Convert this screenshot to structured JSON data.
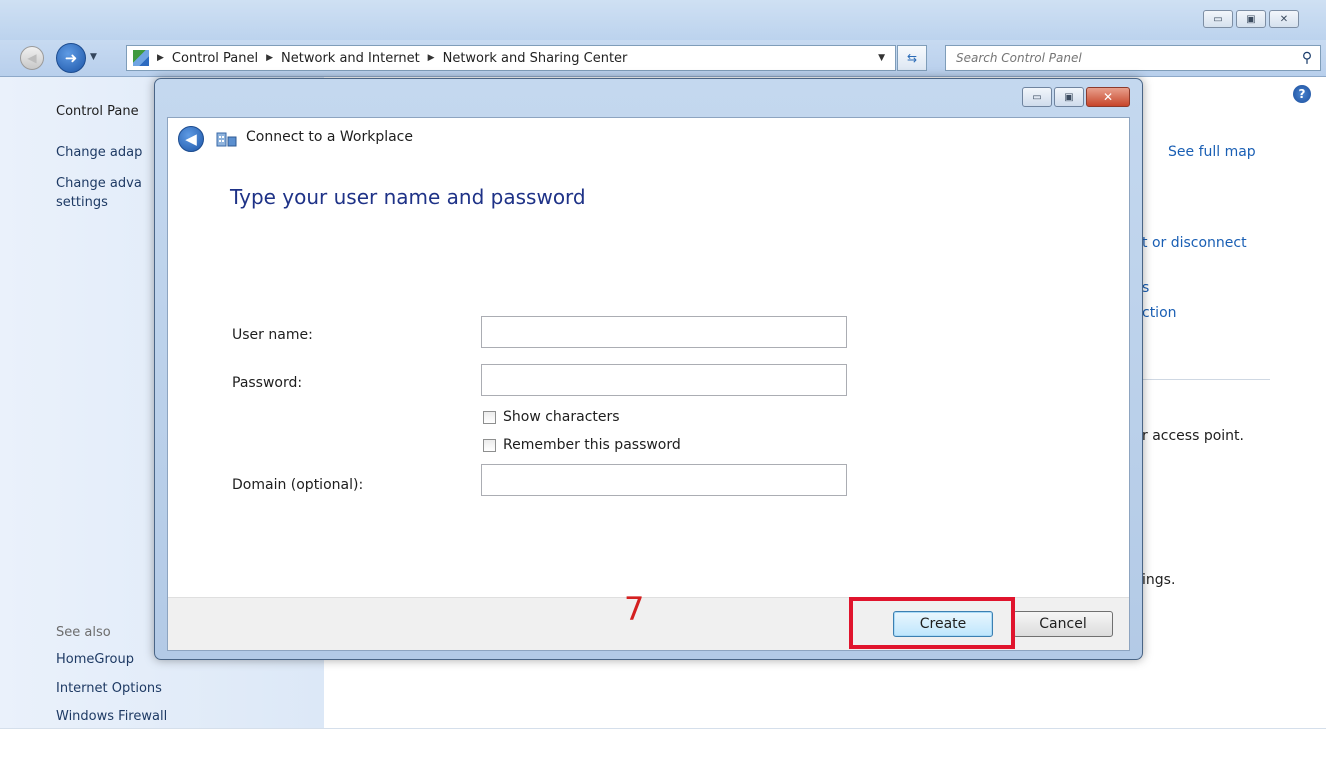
{
  "breadcrumbs": [
    "Control Panel",
    "Network and Internet",
    "Network and Sharing Center"
  ],
  "search": {
    "placeholder": "Search Control Panel"
  },
  "sidebar": {
    "items": [
      "Control Pane",
      "Change adap",
      "Change adva",
      "settings"
    ],
    "see_also": "See also",
    "links": [
      "HomeGroup",
      "Internet Options",
      "Windows Firewall"
    ]
  },
  "right_panel": {
    "see_full_map": "See full map",
    "frag1": "t or disconnect",
    "frag2": "s",
    "frag3": "ction",
    "frag4": "r access point.",
    "frag5": "ings."
  },
  "dialog": {
    "title": "Connect to a Workplace",
    "heading": "Type your user name and password",
    "fields": {
      "username_label": "User name:",
      "username_value": "",
      "password_label": "Password:",
      "password_value": "",
      "domain_label": "Domain (optional):",
      "domain_value": ""
    },
    "checkboxes": {
      "show_characters": "Show characters",
      "remember_password": "Remember this password"
    },
    "buttons": {
      "create": "Create",
      "cancel": "Cancel"
    }
  },
  "annotation": {
    "step": "7",
    "highlight_color": "#e0142d"
  }
}
